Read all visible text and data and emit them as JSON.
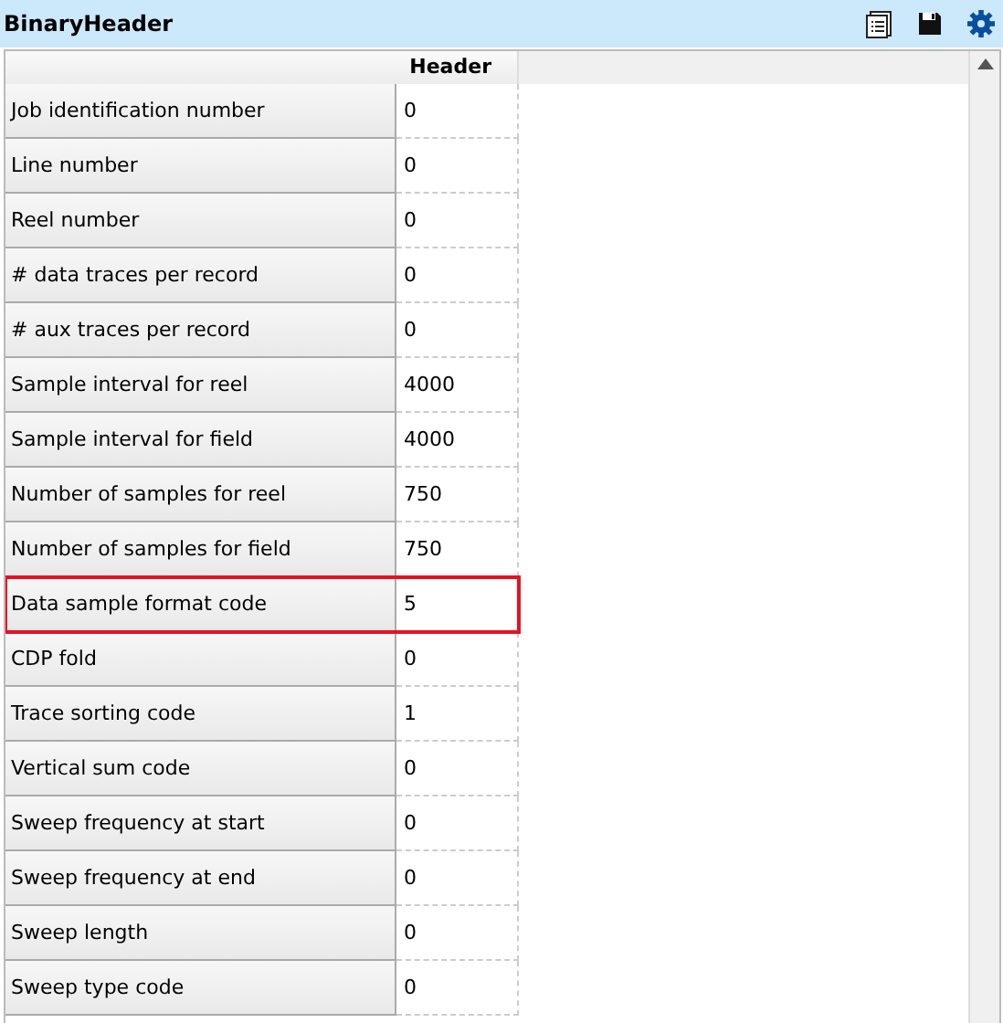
{
  "window": {
    "title": "BinaryHeader"
  },
  "table": {
    "columns": [
      "Header"
    ],
    "rows": [
      {
        "label": "Job identification number",
        "value": "0",
        "highlighted": false
      },
      {
        "label": "Line number",
        "value": "0",
        "highlighted": false
      },
      {
        "label": "Reel number",
        "value": "0",
        "highlighted": false
      },
      {
        "label": "# data traces per record",
        "value": "0",
        "highlighted": false
      },
      {
        "label": "# aux traces per record",
        "value": "0",
        "highlighted": false
      },
      {
        "label": "Sample interval for reel",
        "value": "4000",
        "highlighted": false
      },
      {
        "label": "Sample interval for field",
        "value": "4000",
        "highlighted": false
      },
      {
        "label": "Number of samples for reel",
        "value": "750",
        "highlighted": false
      },
      {
        "label": "Number of samples for field",
        "value": "750",
        "highlighted": false
      },
      {
        "label": "Data sample format code",
        "value": "5",
        "highlighted": true
      },
      {
        "label": "CDP fold",
        "value": "0",
        "highlighted": false
      },
      {
        "label": "Trace sorting code",
        "value": "1",
        "highlighted": false
      },
      {
        "label": "Vertical sum code",
        "value": "0",
        "highlighted": false
      },
      {
        "label": "Sweep frequency at start",
        "value": "0",
        "highlighted": false
      },
      {
        "label": "Sweep frequency at end",
        "value": "0",
        "highlighted": false
      },
      {
        "label": "Sweep length",
        "value": "0",
        "highlighted": false
      },
      {
        "label": "Sweep type code",
        "value": "0",
        "highlighted": false
      }
    ]
  }
}
